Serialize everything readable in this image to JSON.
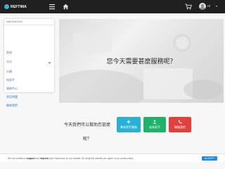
{
  "header": {
    "logo_text": "REFTIMA",
    "user_label": "Hi",
    "bg_color": "#202020"
  },
  "sidebar": {
    "header": "NAVIGATION",
    "items": [
      {
        "label": "首頁"
      },
      {
        "label": "服務"
      },
      {
        "label": "分類"
      },
      {
        "label": "找幫手"
      },
      {
        "label": "服務中心"
      },
      {
        "label": "常見問題"
      },
      {
        "label": "聯絡我們"
      }
    ]
  },
  "hero": {
    "heading": "您今天需要甚麼服務呢？"
  },
  "help": {
    "text": "今天我們可以幫助您甚麼呢？",
    "buttons": [
      {
        "label": "尋求幫手服務",
        "icon": "plus-icon",
        "color": "#2ab0d4"
      },
      {
        "label": "成為幫手",
        "icon": "person-icon",
        "color": "#20b26a"
      },
      {
        "label": "聯絡我們",
        "icon": "phone-icon",
        "color": "#e0413c"
      }
    ]
  },
  "cookie": {
    "text_1": "We use cookies to ",
    "bold_1": "support",
    "text_2": " and ",
    "bold_2": "improve",
    "text_3": " your experience on our website. By using this website you agree to our cookie policy.",
    "accept_label": "ACCEPT"
  }
}
